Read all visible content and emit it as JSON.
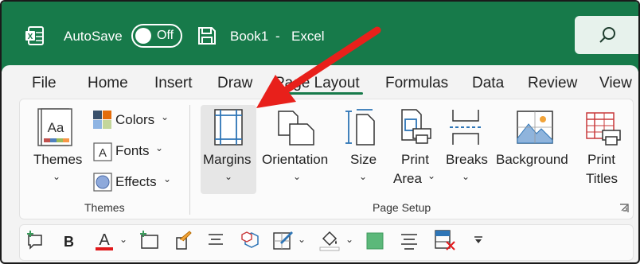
{
  "titlebar": {
    "autosave_label": "AutoSave",
    "autosave_state": "Off",
    "document_title": "Book1",
    "separator": "-",
    "app_name": "Excel"
  },
  "tabs": [
    "File",
    "Home",
    "Insert",
    "Draw",
    "Page Layout",
    "Formulas",
    "Data",
    "Review",
    "View"
  ],
  "active_tab": "Page Layout",
  "ribbon": {
    "themes_group": {
      "themes_label": "Themes",
      "colors_label": "Colors",
      "fonts_label": "Fonts",
      "effects_label": "Effects",
      "group_label": "Themes"
    },
    "page_setup_group": {
      "margins_label": "Margins",
      "orientation_label": "Orientation",
      "size_label": "Size",
      "print_area_line1": "Print",
      "print_area_line2": "Area",
      "breaks_label": "Breaks",
      "background_label": "Background",
      "print_titles_line1": "Print",
      "print_titles_line2": "Titles",
      "group_label": "Page Setup"
    }
  },
  "qat": {
    "bold_label": "B",
    "font_color_label": "A"
  },
  "colors": {
    "title_green": "#177a4a",
    "arrow_red": "#e8201b",
    "accent_blue": "#2e75b6"
  }
}
